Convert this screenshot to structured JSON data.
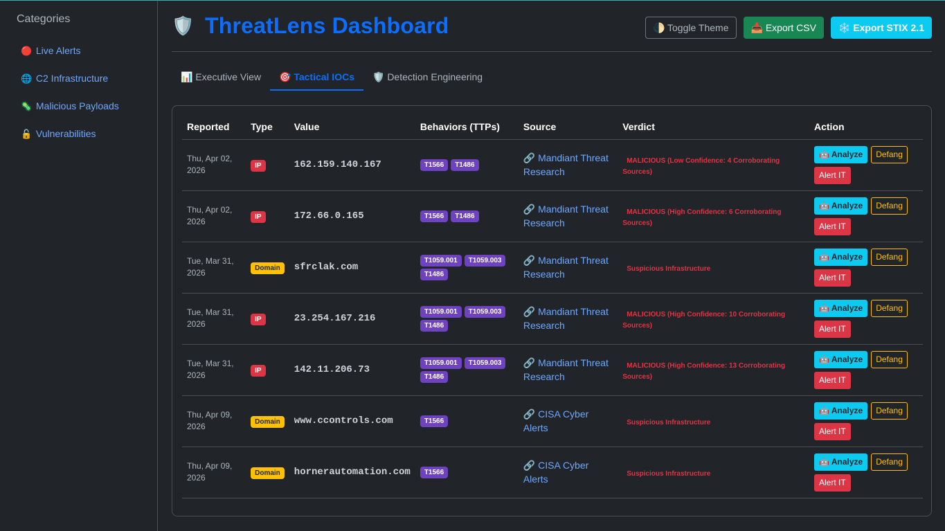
{
  "sidebar": {
    "title": "Categories",
    "items": [
      {
        "icon": "🔴",
        "label": "Live Alerts"
      },
      {
        "icon": "🌐",
        "label": "C2 Infrastructure"
      },
      {
        "icon": "🦠",
        "label": "Malicious Payloads"
      },
      {
        "icon": "🔓",
        "label": "Vulnerabilities"
      }
    ]
  },
  "header": {
    "icon": "🛡️",
    "title": "ThreatLens Dashboard",
    "toggle_theme": "🌓 Toggle Theme",
    "export_csv": "📥 Export CSV",
    "export_stix": "❄️ Export STIX 2.1"
  },
  "tabs": [
    {
      "label": "📊 Executive View"
    },
    {
      "label": "🎯 Tactical IOCs",
      "active": true
    },
    {
      "label": "🛡️ Detection Engineering"
    }
  ],
  "table": {
    "headers": [
      "Reported",
      "Type",
      "Value",
      "Behaviors (TTPs)",
      "Source",
      "Verdict",
      "Action"
    ],
    "action_labels": {
      "analyze": "🤖 Analyze",
      "defang": "Defang",
      "alert": "Alert IT"
    },
    "rows": [
      {
        "date1": "Thu, Apr 02,",
        "date2": "2026",
        "type": "IP",
        "value": "162.159.140.167",
        "ttps": [
          "T1566",
          "T1486"
        ],
        "source": "🔗 Mandiant Threat Research",
        "verdict": "MALICIOUS (Low Confidence: 4 Corroborating Sources)"
      },
      {
        "date1": "Thu, Apr 02,",
        "date2": "2026",
        "type": "IP",
        "value": "172.66.0.165",
        "ttps": [
          "T1566",
          "T1486"
        ],
        "source": "🔗 Mandiant Threat Research",
        "verdict": "MALICIOUS (High Confidence: 6 Corroborating Sources)"
      },
      {
        "date1": "Tue, Mar 31,",
        "date2": "2026",
        "type": "Domain",
        "value": "sfrclak.com",
        "ttps": [
          "T1059.001",
          "T1059.003",
          "T1486"
        ],
        "source": "🔗 Mandiant Threat Research",
        "verdict": "Suspicious Infrastructure"
      },
      {
        "date1": "Tue, Mar 31,",
        "date2": "2026",
        "type": "IP",
        "value": "23.254.167.216",
        "ttps": [
          "T1059.001",
          "T1059.003",
          "T1486"
        ],
        "source": "🔗 Mandiant Threat Research",
        "verdict": "MALICIOUS (High Confidence: 10 Corroborating Sources)"
      },
      {
        "date1": "Tue, Mar 31,",
        "date2": "2026",
        "type": "IP",
        "value": "142.11.206.73",
        "ttps": [
          "T1059.001",
          "T1059.003",
          "T1486"
        ],
        "source": "🔗 Mandiant Threat Research",
        "verdict": "MALICIOUS (High Confidence: 13 Corroborating Sources)"
      },
      {
        "date1": "Thu, Apr 09,",
        "date2": "2026",
        "type": "Domain",
        "value": "www.ccontrols.com",
        "ttps": [
          "T1566"
        ],
        "source": "🔗 CISA Cyber Alerts",
        "verdict": "Suspicious Infrastructure"
      },
      {
        "date1": "Thu, Apr 09,",
        "date2": "2026",
        "type": "Domain",
        "value": "hornerautomation.com",
        "ttps": [
          "T1566"
        ],
        "source": "🔗 CISA Cyber Alerts",
        "verdict": "Suspicious Infrastructure"
      }
    ]
  }
}
